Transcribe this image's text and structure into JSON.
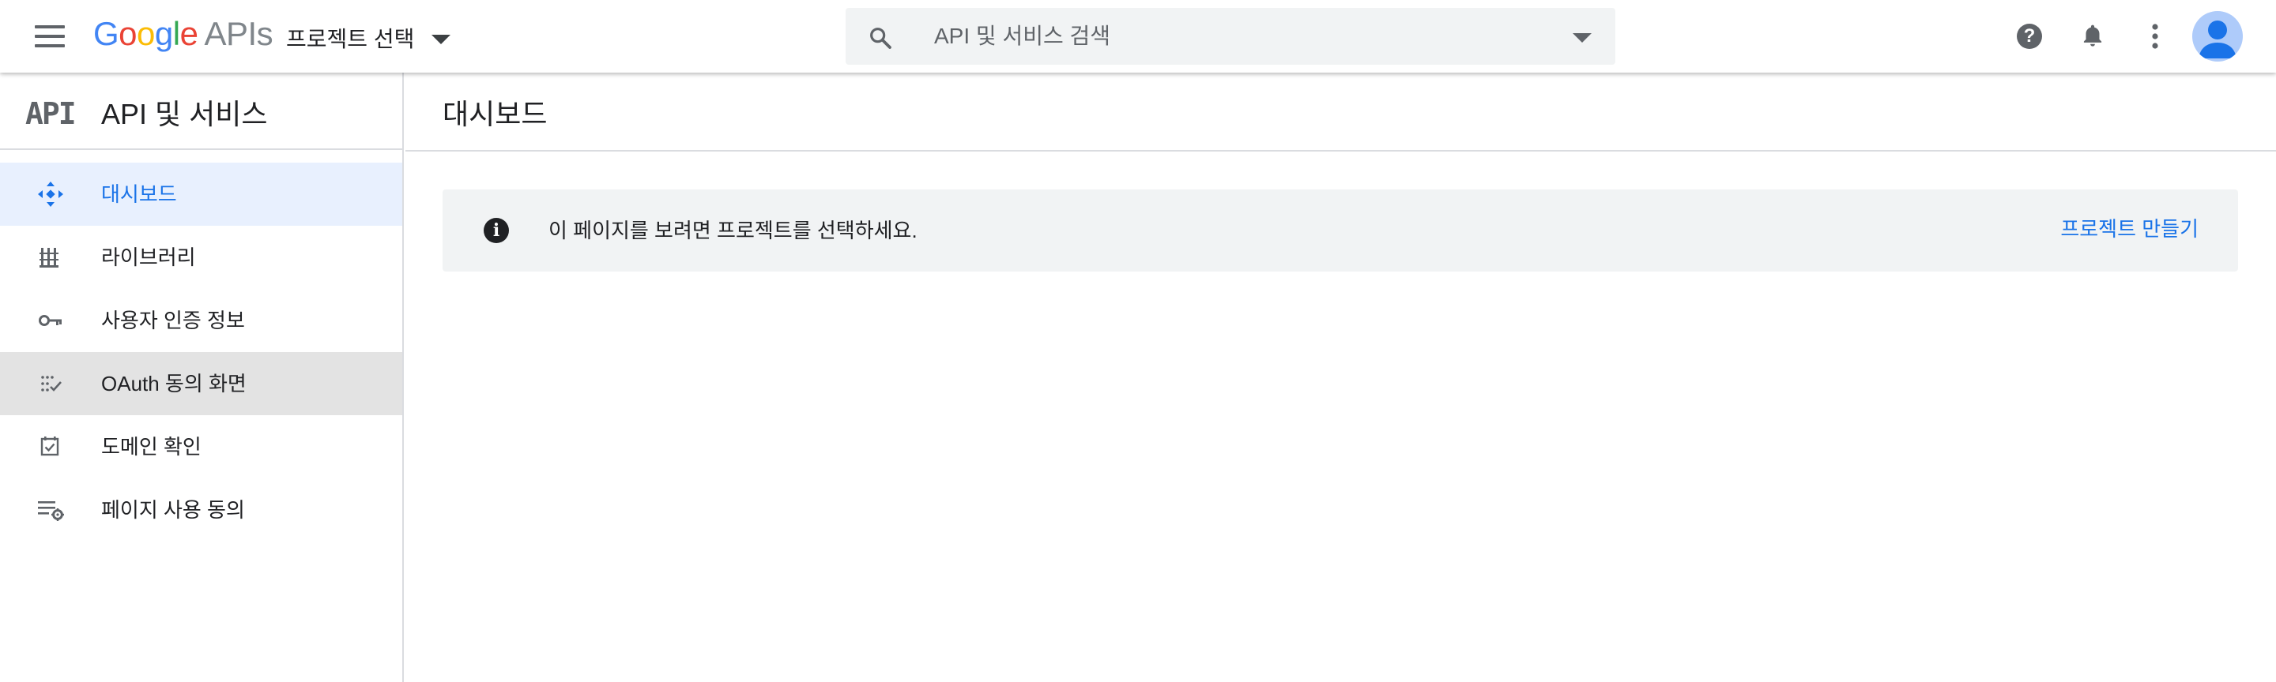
{
  "header": {
    "logo_google": [
      "G",
      "o",
      "o",
      "g",
      "l",
      "e"
    ],
    "logo_suffix": "APIs",
    "project_picker_label": "프로젝트 선택",
    "search_placeholder": "API 및 서비스 검색",
    "help_symbol": "?",
    "icons": [
      "menu-icon",
      "search-icon",
      "help-icon",
      "bell-icon",
      "more-vert-icon",
      "account-icon"
    ]
  },
  "sidebar": {
    "logo_text": "API",
    "title": "API 및 서비스",
    "items": [
      {
        "label": "대시보드",
        "icon": "dashboard-icon",
        "state": "active"
      },
      {
        "label": "라이브러리",
        "icon": "library-icon",
        "state": ""
      },
      {
        "label": "사용자 인증 정보",
        "icon": "key-icon",
        "state": ""
      },
      {
        "label": "OAuth 동의 화면",
        "icon": "consent-icon",
        "state": "hover"
      },
      {
        "label": "도메인 확인",
        "icon": "domain-check-icon",
        "state": ""
      },
      {
        "label": "페이지 사용 동의",
        "icon": "page-settings-icon",
        "state": ""
      }
    ]
  },
  "main": {
    "page_title": "대시보드",
    "notice": {
      "icon_symbol": "i",
      "message": "이 페이지를 보려면 프로젝트를 선택하세요.",
      "action_label": "프로젝트 만들기"
    }
  },
  "colors": {
    "accent": "#1a73e8",
    "active_bg": "#e8f0fe",
    "hover_bg": "#e3e3e3",
    "notice_bg": "#f1f3f4",
    "icon_gray": "#5f6368"
  }
}
